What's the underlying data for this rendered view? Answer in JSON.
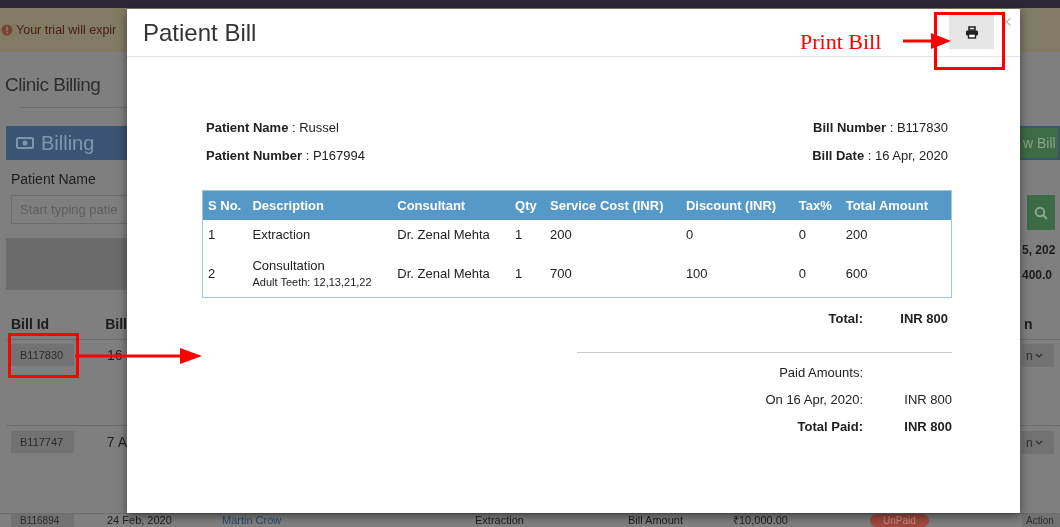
{
  "banner": {
    "text": "Your trial will expir"
  },
  "page_title": "Clinic Billing",
  "billing_panel": {
    "title": "Billing",
    "new_bill_button": "w Bill",
    "patient_label": "Patient Name",
    "patient_placeholder": "Start typing patie",
    "summary": [
      "5, 202",
      "400.0"
    ]
  },
  "bills_table": {
    "columns": [
      "Bill Id",
      "Bill"
    ],
    "last_column": "n",
    "rows": [
      {
        "bill_id": "B117830",
        "date": "16",
        "action": "n"
      },
      {
        "bill_id": "B117747",
        "date": "7 A",
        "action": "n"
      },
      {
        "bill_id": "B116894",
        "date": "24 Feb, 2020",
        "patient": "Martin Crow",
        "description": "Extraction",
        "amount_label": "Bill Amount",
        "amount": "₹10,000.00",
        "status": "UnPaid",
        "action": "Action"
      }
    ]
  },
  "modal": {
    "title": "Patient Bill",
    "close": "×",
    "info_left": [
      "**Patient Name** : Russel",
      "**Patient Number** : P167994"
    ],
    "info_right": [
      "**Bill Number** : B117830",
      "**Bill Date** : 16 Apr, 2020"
    ],
    "table": {
      "columns": [
        "S No.",
        "Description",
        "Consultant",
        "Qty",
        "Service Cost (INR)",
        "Discount (INR)",
        "Tax%",
        "Total Amount"
      ],
      "rows": [
        {
          "cells": [
            "1",
            "Extraction",
            "Dr. Zenal Mehta",
            "1",
            "200",
            "0",
            "0",
            "200"
          ]
        },
        {
          "cells": [
            "2",
            "Consultation",
            "Dr. Zenal Mehta",
            "1",
            "700",
            "100",
            "0",
            "600"
          ],
          "note": "Adult Teeth: 12,13,21,22"
        }
      ]
    },
    "total": {
      "label": "Total:",
      "value": "INR 800"
    },
    "payments": [
      {
        "label": "Paid Amounts:",
        "bold": false
      },
      {
        "label": "On 16 Apr, 2020:",
        "value": "INR 800",
        "bold": false
      },
      {
        "label": "Total Paid:",
        "value": "INR 800",
        "bold": true
      }
    ]
  },
  "annotation": {
    "label": "Print Bill"
  }
}
